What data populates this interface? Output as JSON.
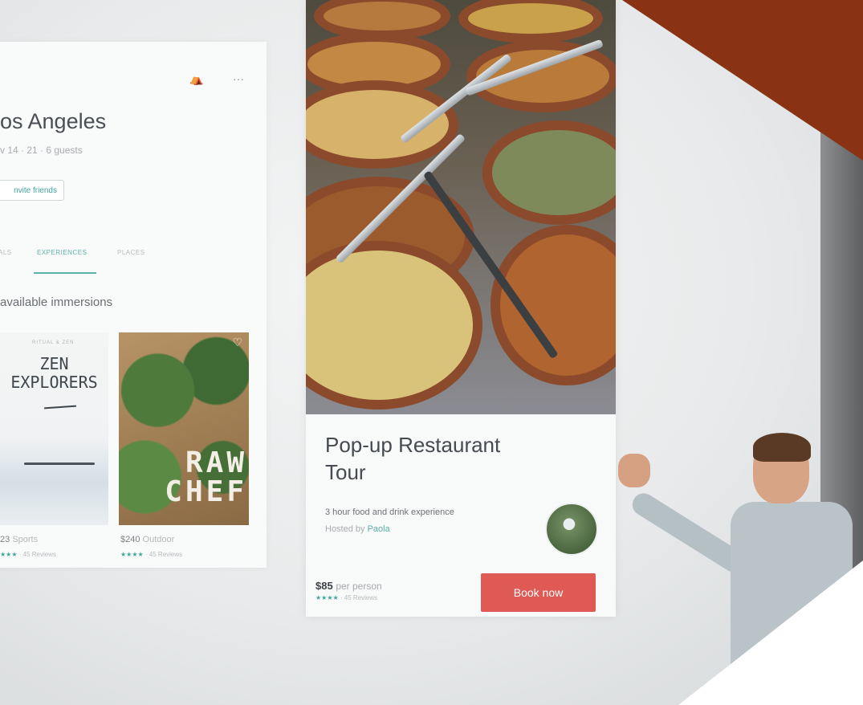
{
  "trip_panel": {
    "title": "os Angeles",
    "subtitle": "v 14 · 21 · 6 guests",
    "invite_label": "nvite friends",
    "icon_a": "pin-icon",
    "icon_b": "more-dots-icon",
    "icon_b_glyph": "···",
    "tabs": [
      "ALS",
      "EXPERIENCES",
      "PLACES"
    ],
    "active_tab": "EXPERIENCES",
    "section_title": "available immersions",
    "cards": [
      {
        "art_small": "RITUAL & ZEN",
        "art_title": "ZEN EXPLORERS",
        "price": "23",
        "category": "Sports",
        "stars": "★★★",
        "reviews": "· 45 Reviews"
      },
      {
        "art_title": "RAW CHEF",
        "price": "$240",
        "category": "Outdoor",
        "stars": "★★★★",
        "reviews": "· 45 Reviews",
        "heart_icon": "heart-icon"
      }
    ]
  },
  "tour_card": {
    "title": "Pop-up Restaurant Tour",
    "description": "3 hour food and drink experience",
    "hosted_by": "Hosted by",
    "host_name": "Paola",
    "price": "$85",
    "price_suffix": "per person",
    "stars": "★★★★",
    "reviews": "· 45 Reviews",
    "book_label": "Book now"
  },
  "colors": {
    "accent_teal": "#44a39b",
    "book_button": "#e05a55",
    "title_text": "#454b51"
  }
}
